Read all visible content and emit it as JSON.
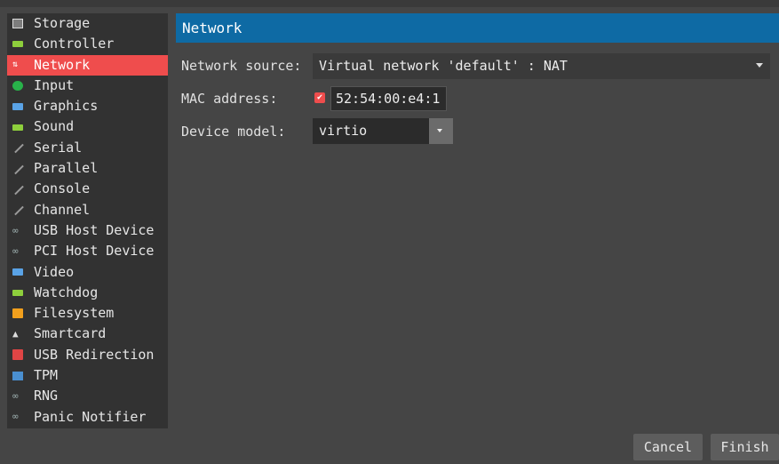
{
  "sidebar": {
    "items": [
      {
        "label": "Storage",
        "icon": "disk-icon"
      },
      {
        "label": "Controller",
        "icon": "card-icon"
      },
      {
        "label": "Network",
        "icon": "network-icon"
      },
      {
        "label": "Input",
        "icon": "input-icon"
      },
      {
        "label": "Graphics",
        "icon": "display-icon"
      },
      {
        "label": "Sound",
        "icon": "card-icon"
      },
      {
        "label": "Serial",
        "icon": "plug-icon"
      },
      {
        "label": "Parallel",
        "icon": "plug-icon"
      },
      {
        "label": "Console",
        "icon": "plug-icon"
      },
      {
        "label": "Channel",
        "icon": "plug-icon"
      },
      {
        "label": "USB Host Device",
        "icon": "usb-icon"
      },
      {
        "label": "PCI Host Device",
        "icon": "usb-icon"
      },
      {
        "label": "Video",
        "icon": "display-icon"
      },
      {
        "label": "Watchdog",
        "icon": "card-icon"
      },
      {
        "label": "Filesystem",
        "icon": "folder-icon"
      },
      {
        "label": "Smartcard",
        "icon": "smartcard-icon"
      },
      {
        "label": "USB Redirection",
        "icon": "usb-redirection-icon"
      },
      {
        "label": "TPM",
        "icon": "tpm-icon"
      },
      {
        "label": "RNG",
        "icon": "usb-icon"
      },
      {
        "label": "Panic Notifier",
        "icon": "usb-icon"
      }
    ],
    "selected": "Network"
  },
  "header": {
    "title": "Network"
  },
  "form": {
    "source_label": "Network source:",
    "source_value": "Virtual network 'default' : NAT",
    "mac_label": "MAC address:",
    "mac_value": "52:54:00:e4:1",
    "model_label": "Device model:",
    "model_value": "virtio"
  },
  "buttons": {
    "cancel": "Cancel",
    "finish": "Finish"
  },
  "colors": {
    "accent": "#ef4d4d",
    "header": "#0e6aa4",
    "background": "#454545"
  }
}
